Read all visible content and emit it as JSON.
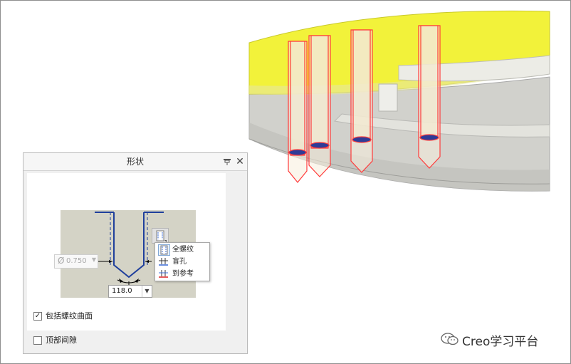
{
  "panel": {
    "title": "形状",
    "close_label": "✕"
  },
  "shape": {
    "diameter_symbol": "Ø",
    "diameter_value": "0.750",
    "angle_value": "118.0"
  },
  "thread_menu": {
    "items": [
      {
        "label": "全螺纹",
        "icon": "full-thread-icon"
      },
      {
        "label": "盲孔",
        "icon": "blind-hole-icon"
      },
      {
        "label": "到参考",
        "icon": "to-reference-icon"
      }
    ]
  },
  "options": {
    "include_thread_surface": {
      "label": "包括螺纹曲面",
      "checked": true,
      "mark": "✓"
    },
    "top_clearance": {
      "label": "顶部间隙",
      "checked": false
    }
  },
  "watermark": {
    "text": "Creo学习平台",
    "icon": "wechat-icon"
  },
  "colors": {
    "yellow_part": "#f2f23a",
    "hole_outline": "#ff3b3b",
    "profile_line": "#1f3f9c"
  }
}
